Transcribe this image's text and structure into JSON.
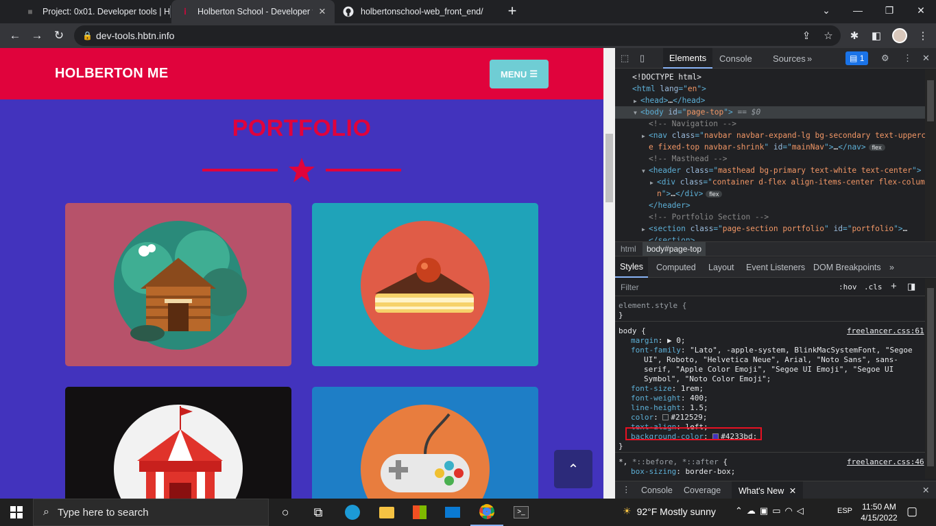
{
  "browser": {
    "tabs": [
      {
        "title": "Project: 0x01. Developer tools | H",
        "favicon": "intranet-icon",
        "active": false
      },
      {
        "title": "Holberton School - Developer to",
        "favicon": "holberton-icon",
        "active": true
      },
      {
        "title": "holbertonschool-web_front_end/",
        "favicon": "github-icon",
        "active": false
      }
    ],
    "close_glyph": "✕",
    "new_tab_glyph": "+",
    "url": "dev-tools.hbtn.info"
  },
  "page": {
    "brand": "HOLBERTON ME",
    "menu_label": "MENU",
    "section_title": "PORTFOLIO",
    "colors": {
      "navbar": "#e0033c",
      "body": "#4233bd",
      "menu": "#6fcdd4"
    },
    "cards": [
      {
        "name": "cabin",
        "bg": "#b7526a"
      },
      {
        "name": "cake",
        "bg": "#1fa3b9"
      },
      {
        "name": "circus",
        "bg": "#121011"
      },
      {
        "name": "game",
        "bg": "#1e7ec6"
      }
    ]
  },
  "devtools": {
    "tabs": [
      "Elements",
      "Console",
      "Sources"
    ],
    "issues_count": "1",
    "dom_lines": [
      {
        "indent": 0,
        "arrow": "",
        "parts": [
          [
            "tx",
            "<!DOCTYPE html>"
          ]
        ]
      },
      {
        "indent": 0,
        "arrow": "",
        "parts": [
          [
            "tg",
            "<html "
          ],
          [
            "at",
            "lang"
          ],
          [
            "tg",
            "=\""
          ],
          [
            "av",
            "en"
          ],
          [
            "tg",
            "\">"
          ]
        ]
      },
      {
        "indent": 1,
        "arrow": "▶",
        "parts": [
          [
            "tg",
            "<head>"
          ],
          [
            "tx",
            "…"
          ],
          [
            "tg",
            "</head>"
          ]
        ]
      },
      {
        "indent": 1,
        "arrow": "▼",
        "parts": [
          [
            "tg",
            "<body "
          ],
          [
            "at",
            "id"
          ],
          [
            "tg",
            "=\""
          ],
          [
            "av",
            "page-top"
          ],
          [
            "tg",
            "\">"
          ],
          [
            "tx",
            " == $0"
          ]
        ],
        "selected": true
      },
      {
        "indent": 2,
        "arrow": "",
        "parts": [
          [
            "cm",
            "<!-- Navigation -->"
          ]
        ]
      },
      {
        "indent": 2,
        "arrow": "▶",
        "parts": [
          [
            "tg",
            "<nav "
          ],
          [
            "at",
            "class"
          ],
          [
            "tg",
            "=\""
          ],
          [
            "av",
            "navbar navbar-expand-lg bg-secondary text-uppercas"
          ]
        ]
      },
      {
        "indent": 2,
        "arrow": "",
        "parts": [
          [
            "av",
            "e fixed-top navbar-shrink"
          ],
          [
            "tg",
            "\" "
          ],
          [
            "at",
            "id"
          ],
          [
            "tg",
            "=\""
          ],
          [
            "av",
            "mainNav"
          ],
          [
            "tg",
            "\">"
          ],
          [
            "tx",
            "…"
          ],
          [
            "tg",
            "</nav>"
          ]
        ],
        "badge": "flex"
      },
      {
        "indent": 2,
        "arrow": "",
        "parts": [
          [
            "cm",
            "<!-- Masthead -->"
          ]
        ]
      },
      {
        "indent": 2,
        "arrow": "▼",
        "parts": [
          [
            "tg",
            "<header "
          ],
          [
            "at",
            "class"
          ],
          [
            "tg",
            "=\""
          ],
          [
            "av",
            "masthead bg-primary text-white text-center"
          ],
          [
            "tg",
            "\">"
          ]
        ]
      },
      {
        "indent": 3,
        "arrow": "▶",
        "parts": [
          [
            "tg",
            "<div "
          ],
          [
            "at",
            "class"
          ],
          [
            "tg",
            "=\""
          ],
          [
            "av",
            "container d-flex align-items-center flex-colum"
          ]
        ]
      },
      {
        "indent": 3,
        "arrow": "",
        "parts": [
          [
            "av",
            "n"
          ],
          [
            "tg",
            "\">"
          ],
          [
            "tx",
            "…"
          ],
          [
            "tg",
            "</div>"
          ]
        ],
        "badge": "flex"
      },
      {
        "indent": 2,
        "arrow": "",
        "parts": [
          [
            "tg",
            "</header>"
          ]
        ]
      },
      {
        "indent": 2,
        "arrow": "",
        "parts": [
          [
            "cm",
            "<!-- Portfolio Section -->"
          ]
        ]
      },
      {
        "indent": 2,
        "arrow": "▶",
        "parts": [
          [
            "tg",
            "<section "
          ],
          [
            "at",
            "class"
          ],
          [
            "tg",
            "=\""
          ],
          [
            "av",
            "page-section portfolio"
          ],
          [
            "tg",
            "\" "
          ],
          [
            "at",
            "id"
          ],
          [
            "tg",
            "=\""
          ],
          [
            "av",
            "portfolio"
          ],
          [
            "tg",
            "\">"
          ],
          [
            "tx",
            "…"
          ]
        ]
      },
      {
        "indent": 2,
        "arrow": "",
        "parts": [
          [
            "tg",
            "</section>"
          ]
        ]
      }
    ],
    "breadcrumbs": [
      "html",
      "body#page-top"
    ],
    "styles_tabs": [
      "Styles",
      "Computed",
      "Layout",
      "Event Listeners",
      "DOM Breakpoints"
    ],
    "filter_placeholder": "Filter",
    "hov": ":hov",
    "cls": ".cls",
    "element_style": "element.style {",
    "body_rule": {
      "selector": "body {",
      "source": "freelancer.css:61",
      "props": [
        {
          "name": "margin",
          "value": "▶ 0;"
        },
        {
          "name": "font-family",
          "value": "\"Lato\", -apple-system, BlinkMacSystemFont, \"Segoe"
        },
        {
          "name": "",
          "value": "UI\", Roboto, \"Helvetica Neue\", Arial, \"Noto Sans\", sans-"
        },
        {
          "name": "",
          "value": "serif, \"Apple Color Emoji\", \"Segoe UI Emoji\", \"Segoe UI"
        },
        {
          "name": "",
          "value": "Symbol\", \"Noto Color Emoji\";"
        },
        {
          "name": "font-size",
          "value": "1rem;"
        },
        {
          "name": "font-weight",
          "value": "400;"
        },
        {
          "name": "line-height",
          "value": "1.5;"
        },
        {
          "name": "color",
          "value": "#212529;",
          "swatch": "#212529"
        },
        {
          "name": "text-align",
          "value": "left;"
        },
        {
          "name": "background-color",
          "value": "#4233bd;",
          "swatch": "#4233bd"
        }
      ]
    },
    "universal_rule": {
      "selector": "*, ",
      "selector_dim": "*::before, *::after",
      "selector_end": " {",
      "source": "freelancer.css:46",
      "prop_name": "box-sizing",
      "prop_value": "border-box;"
    },
    "drawer_tabs": [
      "Console",
      "Coverage",
      "What's New"
    ]
  },
  "taskbar": {
    "search_placeholder": "Type here to search",
    "weather": "92°F  Mostly sunny",
    "lang": "ESP",
    "time": "11:50 AM",
    "date": "4/15/2022"
  }
}
